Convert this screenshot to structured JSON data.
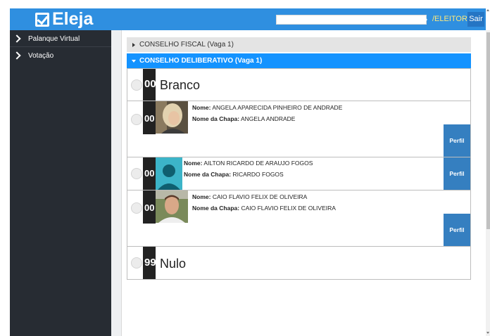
{
  "header": {
    "logo_text": "Eleja",
    "user_name": "",
    "role": "/ELEITOR",
    "exit_label": "Sair",
    "accent_color": "#2f8fe0"
  },
  "sidebar": {
    "items": [
      {
        "label": "Palanque Virtual",
        "icon": "chevron-right-icon"
      },
      {
        "label": "Votação",
        "icon": "chevron-right-icon"
      }
    ]
  },
  "accordion": {
    "fiscal_label": "CONSELHO FISCAL (Vaga 1)",
    "deliberativo_label": "CONSELHO DELIBERATIVO (Vaga 1)",
    "active_color": "#1493ff"
  },
  "candidates": {
    "branco": {
      "number": "00",
      "name": "Branco"
    },
    "c1": {
      "number": "00",
      "nome_label": "Nome:",
      "nome": "ANGELA APARECIDA PINHEIRO DE ANDRADE",
      "chapa_label": "Nome da Chapa:",
      "chapa": "ANGELA ANDRADE",
      "perfil": "Perfil"
    },
    "c2": {
      "number": "00",
      "nome_label": "Nome:",
      "nome": "AILTON RICARDO DE ARAUJO FOGOS",
      "chapa_label": "Nome da Chapa:",
      "chapa": "RICARDO FOGOS",
      "perfil": "Perfil"
    },
    "c3": {
      "number": "00",
      "nome_label": "Nome:",
      "nome": "CAIO FLAVIO FELIX DE OLIVEIRA",
      "chapa_label": "Nome da Chapa:",
      "chapa": "CAIO FLAVIO FELIX DE OLIVEIRA",
      "perfil": "Perfil"
    },
    "nulo": {
      "number": "99",
      "name": "Nulo"
    }
  }
}
